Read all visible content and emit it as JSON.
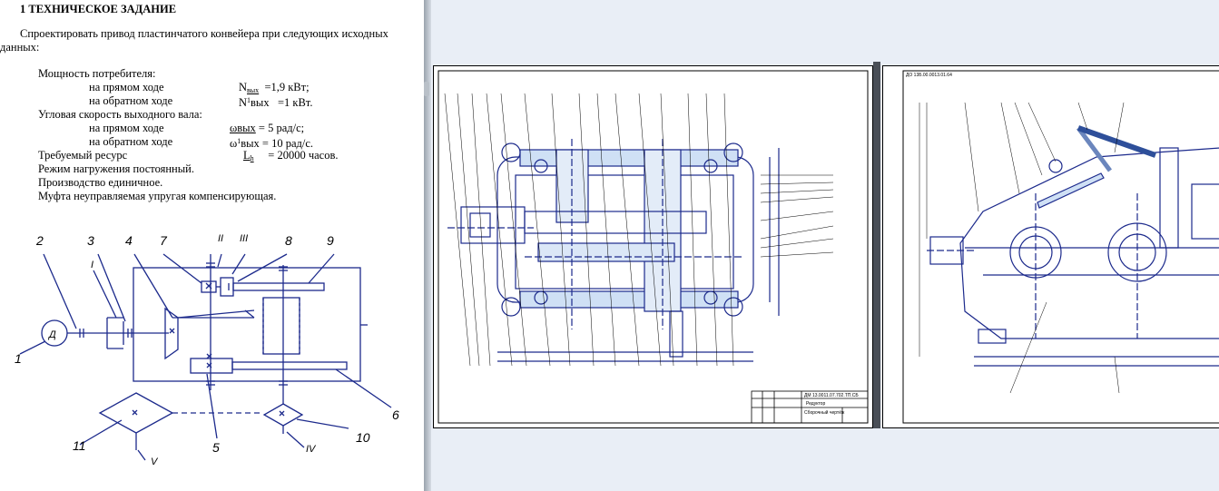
{
  "document": {
    "heading": "1  ТЕХНИЧЕСКОЕ ЗАДАНИЕ",
    "intro_line1": "Спроектировать привод пластинчатого конвейера при следующих исходных",
    "intro_line2": "данных:",
    "power_label": "Мощность потребителя:",
    "power_forward_label": "на прямом ходе",
    "power_forward_sym": "N",
    "power_forward_sub": "вых",
    "power_forward_val": "=1,9 кВт;",
    "power_back_label": "на обратном ходе",
    "power_back_sym": "N",
    "power_back_sup": "1",
    "power_back_sub": "вых",
    "power_back_val": "=1 кВт.",
    "speed_label": "Угловая скорость выходного вала:",
    "speed_forward_label": "на прямом ходе",
    "speed_forward_sym": "ωвых",
    "speed_forward_val": " = 5 рад/с;",
    "speed_back_label": "на обратном ходе",
    "speed_back_sym": "ω",
    "speed_back_sup": "1",
    "speed_back_sub": "вых",
    "speed_back_val": " = 10 рад/с.",
    "resource_label": "Требуемый ресурс",
    "resource_sym": "L",
    "resource_sub": "h",
    "resource_val": "= 20000 часов.",
    "mode_line": "Режим нагружения постоянный.",
    "production_line": "Производство единичное.",
    "coupling_line": "Муфта неуправляемая упругая компенсирующая."
  },
  "scheme_labels": {
    "n1": "1",
    "n2": "2",
    "n3": "3",
    "n4": "4",
    "n5": "5",
    "n6": "6",
    "n7": "7",
    "n8": "8",
    "n9": "9",
    "n10": "10",
    "n11": "11",
    "rI": "I",
    "rII": "II",
    "rIII": "III",
    "rIV": "IV",
    "rV": "V",
    "motor": "Д"
  },
  "drawing1": {
    "title_code": "ДМ 13.0011.07.702.ТП.СБ",
    "title_name": "Редуктор",
    "title_sub": "Сборочный чертёж"
  },
  "drawing2": {
    "corner_code": "ДО 13Б.00.0013.01.64"
  }
}
